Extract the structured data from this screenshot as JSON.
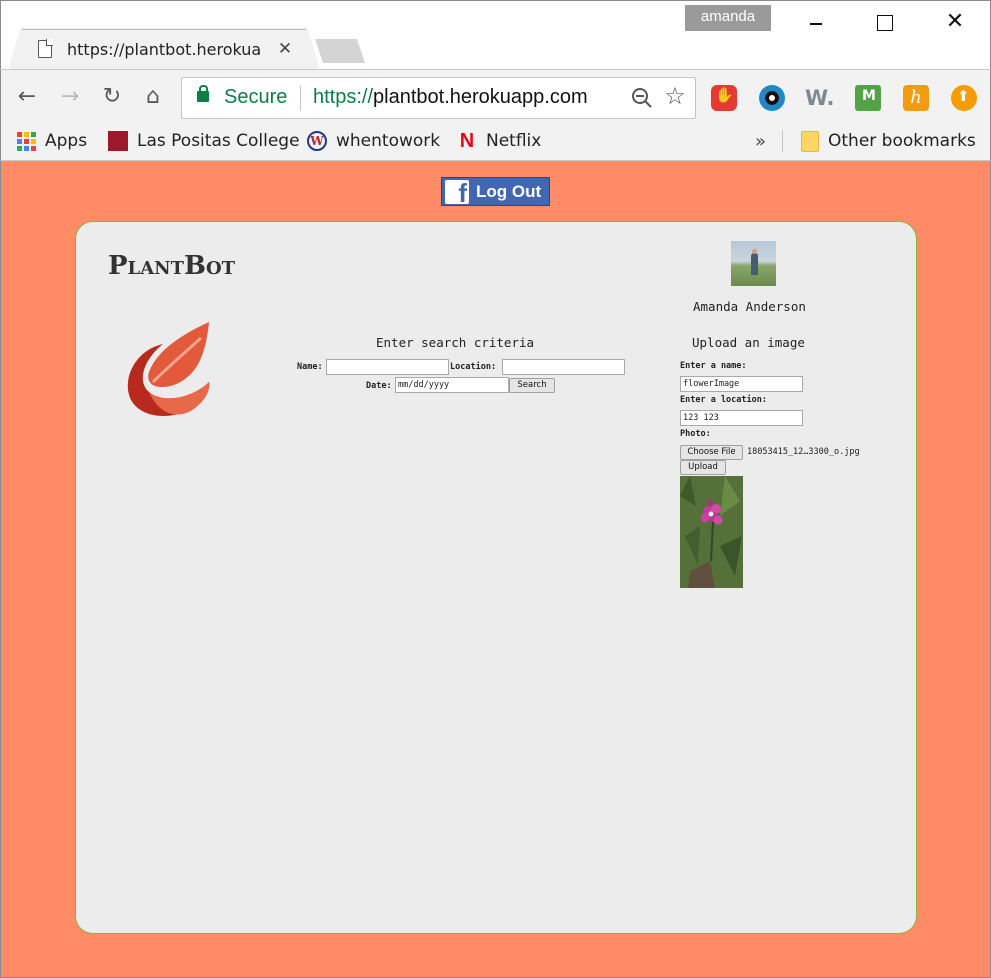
{
  "browser": {
    "tab_title": "https://plantbot.herokua",
    "tab_close": "✕",
    "user_badge": "amanda",
    "window_close": "✕",
    "nav": {
      "back": "←",
      "forward": "→",
      "reload": "↻",
      "home": "⌂"
    },
    "omnibox": {
      "secure_label": "Secure",
      "url_scheme": "https://",
      "url_host": "plantbot.herokuapp.com"
    },
    "star_glyph": "☆",
    "extensions": {
      "w_label": "W."
    },
    "bookmarks": {
      "apps": "Apps",
      "items": [
        "Las Positas College",
        "whentowork",
        "Netflix"
      ],
      "more": "»",
      "other": "Other bookmarks"
    },
    "bookmark_icon_letters": {
      "w2w": "W",
      "netflix": "N"
    },
    "apps_grid_colors": [
      "#ea4335",
      "#fbbc05",
      "#34a853",
      "#4285f4",
      "#ea4335",
      "#fbbc05",
      "#34a853",
      "#4285f4",
      "#ea4335"
    ]
  },
  "page": {
    "logout_label": "Log Out",
    "brand": "PlantBot",
    "user_name": "Amanda Anderson",
    "search": {
      "title": "Enter search criteria",
      "name_label": "Name:",
      "name_value": "",
      "location_label": "Location:",
      "location_value": "",
      "date_label": "Date:",
      "date_placeholder": "mm/dd/yyyy",
      "button": "Search"
    },
    "upload": {
      "title": "Upload an image",
      "name_label": "Enter a name:",
      "name_value": "flowerImage",
      "location_label": "Enter a location:",
      "location_value": "123 123",
      "photo_label": "Photo:",
      "choose_button": "Choose File",
      "file_name": "18053415_12…3300_o.jpg",
      "upload_button": "Upload"
    },
    "colors": {
      "background": "#ff8c66",
      "card": "#ececec",
      "card_border": "#8fb33a",
      "facebook": "#4267b2"
    }
  }
}
